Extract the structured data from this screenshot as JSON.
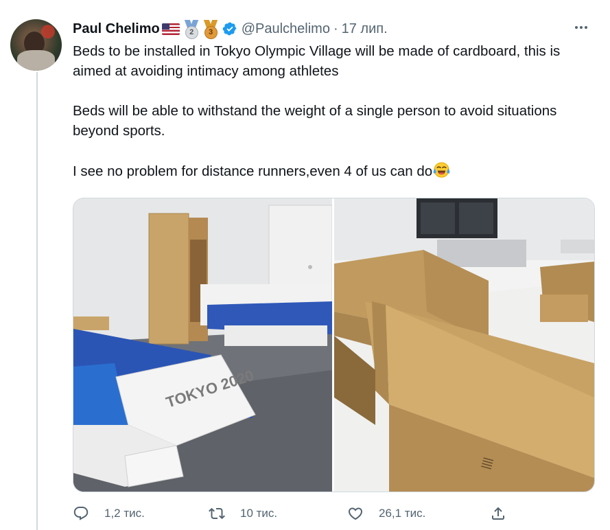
{
  "user": {
    "name": "Paul Chelimo",
    "handle": "@Paulchelimo",
    "separator": "·",
    "date": "17 лип.",
    "medals": [
      {
        "type": "silver",
        "number": "2"
      },
      {
        "type": "bronze",
        "number": "3"
      }
    ]
  },
  "tweet": {
    "paragraphs": [
      "Beds to be installed in Tokyo Olympic Village will be made of cardboard, this is aimed at avoiding intimacy among athletes",
      "Beds will be able to withstand the weight of a single person to avoid situations beyond sports.",
      "I see no problem for distance runners,even 4 of us can do"
    ],
    "bedding_print": "TOKYO 2020"
  },
  "actions": {
    "replies": "1,2 тис.",
    "retweets": "10 тис.",
    "likes": "26,1 тис."
  },
  "colors": {
    "text_primary": "#0f1419",
    "text_secondary": "#536471",
    "verified": "#1d9bf0",
    "border": "#cfd9de"
  }
}
